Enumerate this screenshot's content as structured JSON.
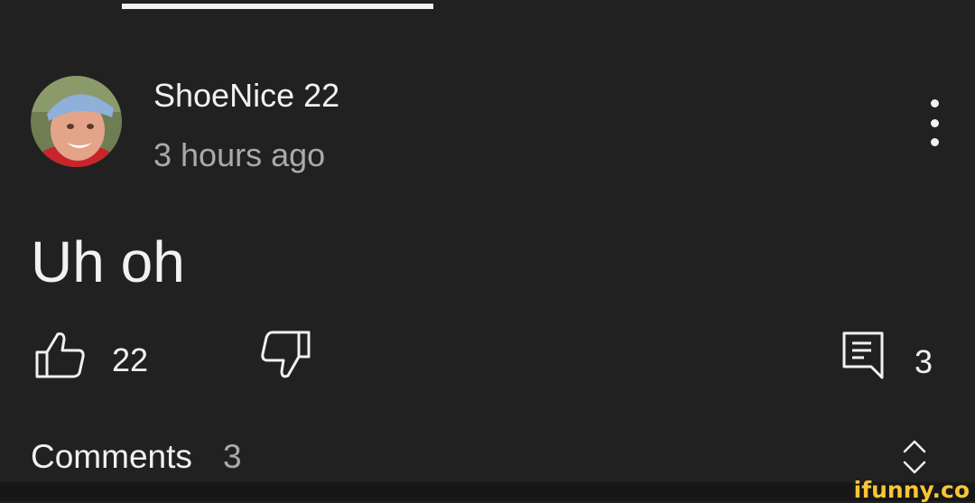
{
  "comment": {
    "author": "ShoeNice 22",
    "timestamp": "3 hours ago",
    "text": "Uh oh",
    "likes": "22",
    "replies": "3"
  },
  "footer": {
    "comments_label": "Comments",
    "comments_count": "3"
  },
  "watermark": "ifunny.co",
  "icons": {
    "like": "thumb-up-outline-icon",
    "dislike": "thumb-down-outline-icon",
    "reply": "reply-comment-icon",
    "more": "vertical-ellipsis-icon",
    "expand": "chevron-up-down-icon"
  },
  "colors": {
    "background": "#212121",
    "primary_text": "#f1f1f1",
    "secondary_text": "#aaaaaa",
    "watermark": "#f6c633"
  }
}
